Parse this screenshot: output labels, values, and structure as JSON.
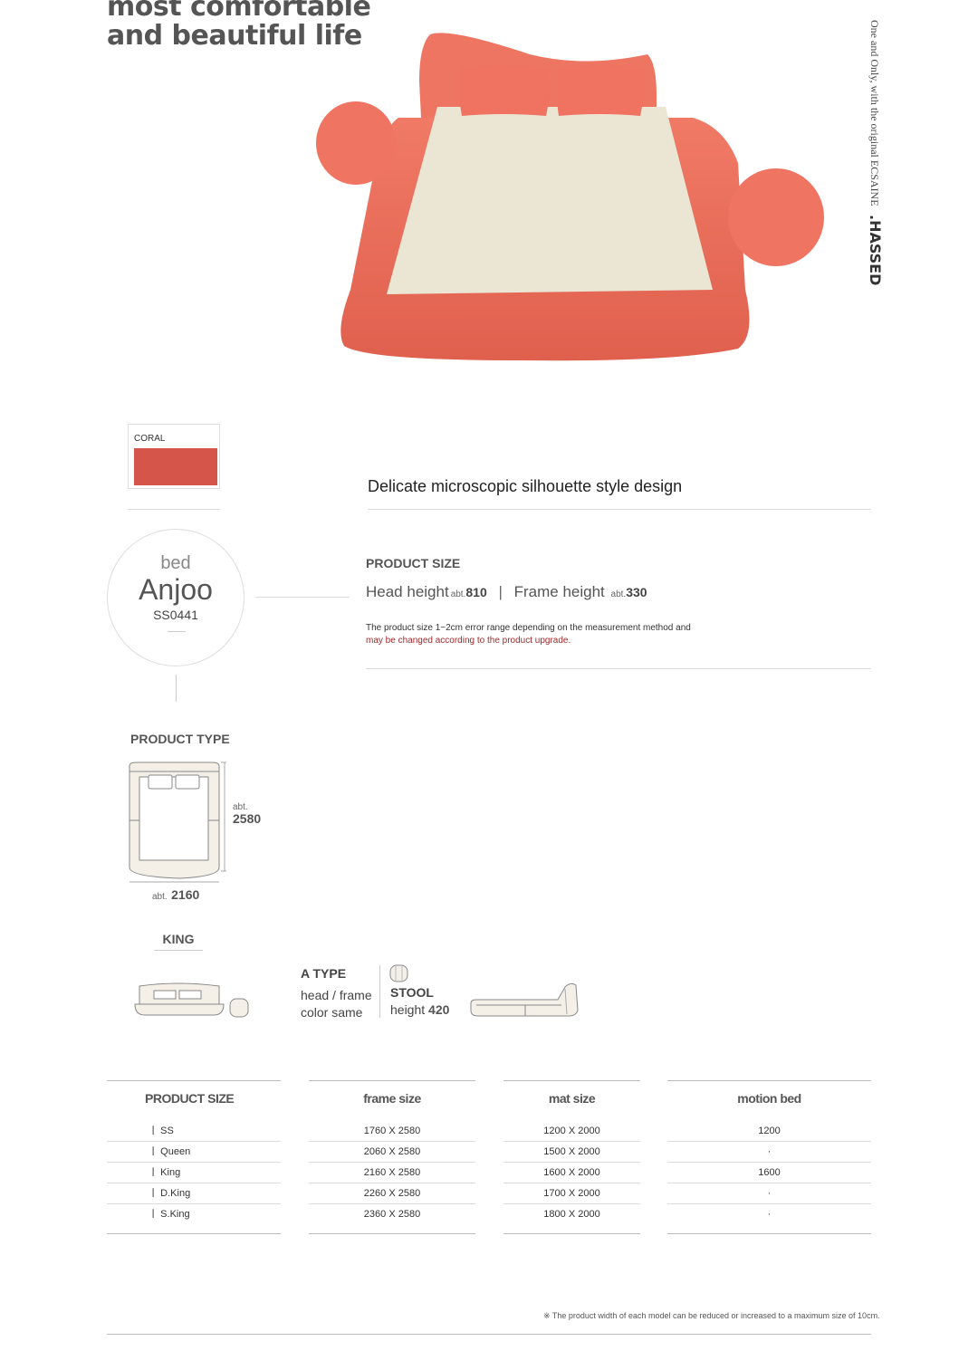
{
  "headline": {
    "line1": "most comfortable",
    "line2": "and beautiful life"
  },
  "vertical": {
    "text": "One and Only, with the original ECSAINE",
    "brand": ".HASSED"
  },
  "swatch": {
    "label": "CORAL",
    "color": "#d6554a"
  },
  "tagline": "Delicate microscopic silhouette style design",
  "badge": {
    "category": "bed",
    "name": "Anjoo",
    "code": "SS0441"
  },
  "product_size": {
    "title": "PRODUCT SIZE",
    "head_label": "Head height",
    "head_abt": "abt.",
    "head_value": "810",
    "separator": "|",
    "frame_label": "Frame height",
    "frame_abt": "abt.",
    "frame_value": "330",
    "note1": "The product size 1~2cm error range depending on the measurement method and",
    "note2": "may be changed according to the product upgrade."
  },
  "product_type": {
    "title": "PRODUCT TYPE",
    "length_abt": "abt.",
    "length_value": "2580",
    "width_abt": "abt.",
    "width_value": "2160"
  },
  "king_label": "KING",
  "a_type": {
    "title": "A TYPE",
    "line1": "head / frame",
    "line2": "color same"
  },
  "stool": {
    "title": "STOOL",
    "label": "height",
    "value": "420"
  },
  "size_table": {
    "headers": [
      "PRODUCT SIZE",
      "frame size",
      "mat size",
      "motion bed"
    ],
    "rows": [
      [
        "ㅣ SS",
        "1760 X 2580",
        "1200 X 2000",
        "1200"
      ],
      [
        "ㅣ Queen",
        "2060 X 2580",
        "1500 X 2000",
        "·"
      ],
      [
        "ㅣ King",
        "2160 X 2580",
        "1600 X 2000",
        "1600"
      ],
      [
        "ㅣ D.King",
        "2260 X 2580",
        "1700 X 2000",
        "·"
      ],
      [
        "ㅣ S.King",
        "2360 X 2580",
        "1800 X 2000",
        "·"
      ]
    ]
  },
  "footnote": "※ The product width of each model can be reduced or increased to a maximum size of 10cm.",
  "colors": {
    "coral": "#e8705e",
    "mattress": "#ece6d6",
    "text_gray": "#555555"
  }
}
